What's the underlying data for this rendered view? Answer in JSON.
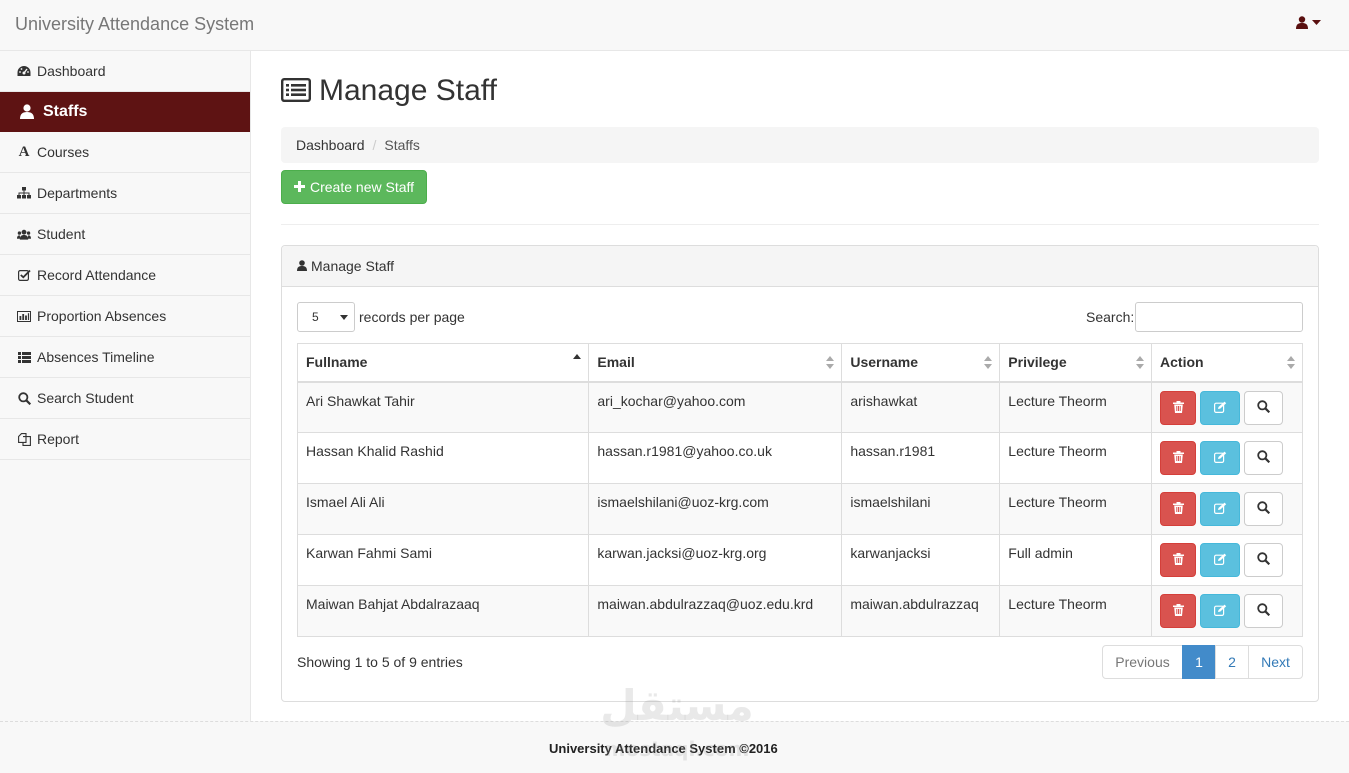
{
  "navbar": {
    "brand": "University Attendance System",
    "user_icon": "user-icon",
    "caret_icon": "caret-down-icon"
  },
  "sidebar": {
    "items": [
      {
        "label": "Dashboard",
        "icon": "dashboard-icon",
        "active": false
      },
      {
        "label": "Staffs",
        "icon": "user-icon",
        "active": true
      },
      {
        "label": "Courses",
        "icon": "font-icon",
        "active": false
      },
      {
        "label": "Departments",
        "icon": "sitemap-icon",
        "active": false
      },
      {
        "label": "Student",
        "icon": "users-icon",
        "active": false
      },
      {
        "label": "Record Attendance",
        "icon": "check-square-icon",
        "active": false
      },
      {
        "label": "Proportion Absences",
        "icon": "bar-chart-icon",
        "active": false
      },
      {
        "label": "Absences Timeline",
        "icon": "list-icon",
        "active": false
      },
      {
        "label": "Search Student",
        "icon": "search-icon",
        "active": false
      },
      {
        "label": "Report",
        "icon": "copy-icon",
        "active": false
      }
    ]
  },
  "main": {
    "title": "Manage Staff",
    "title_icon": "list-alt-icon",
    "breadcrumb": [
      "Dashboard",
      "Staffs"
    ],
    "create_button": "Create new Staff",
    "panel_title": "Manage Staff",
    "length": {
      "value": "5",
      "label": "records per page"
    },
    "search_label": "Search:",
    "columns": [
      "Fullname",
      "Email",
      "Username",
      "Privilege",
      "Action"
    ],
    "rows": [
      {
        "fullname": "Ari Shawkat Tahir",
        "email": "ari_kochar@yahoo.com",
        "username": "arishawkat",
        "privilege": "Lecture Theorm"
      },
      {
        "fullname": "Hassan Khalid Rashid",
        "email": "hassan.r1981@yahoo.co.uk",
        "username": "hassan.r1981",
        "privilege": "Lecture Theorm"
      },
      {
        "fullname": "Ismael Ali Ali",
        "email": "ismaelshilani@uoz-krg.com",
        "username": "ismaelshilani",
        "privilege": "Lecture Theorm"
      },
      {
        "fullname": "Karwan Fahmi Sami",
        "email": "karwan.jacksi@uoz-krg.org",
        "username": "karwanjacksi",
        "privilege": "Full admin"
      },
      {
        "fullname": "Maiwan Bahjat Abdalrazaaq",
        "email": "maiwan.abdulrazzaq@uoz.edu.krd",
        "username": "maiwan.abdulrazzaq",
        "privilege": "Lecture Theorm"
      }
    ],
    "info": "Showing 1 to 5 of 9 entries",
    "pagination": {
      "previous": "Previous",
      "pages": [
        "1",
        "2"
      ],
      "next": "Next",
      "current": "1"
    }
  },
  "footer": {
    "text": "University Attendance System ©2016"
  },
  "watermark": {
    "text_top": "مستقل",
    "text_bottom": "mostaql.com"
  },
  "colors": {
    "accent": "#5e1313",
    "success": "#5cb85c",
    "danger": "#d9534f",
    "info": "#5bc0de",
    "primary": "#428bca"
  }
}
